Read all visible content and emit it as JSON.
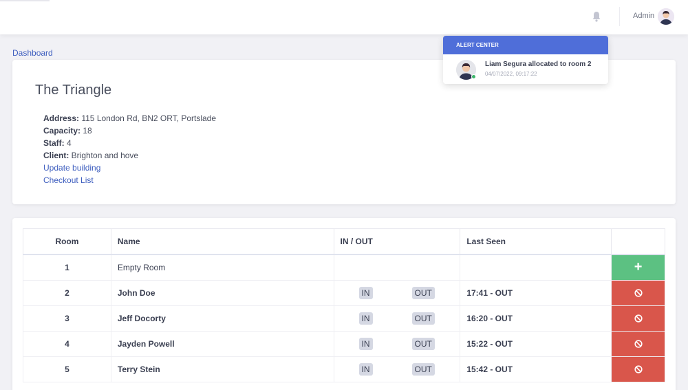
{
  "header": {
    "user_name": "Admin"
  },
  "breadcrumb": {
    "label": "Dashboard"
  },
  "building": {
    "title": "The Triangle",
    "address_label": "Address:",
    "address": " 115 London Rd, BN2 ORT, Portslade",
    "capacity_label": "Capacity:",
    "capacity": " 18",
    "staff_label": "Staff:",
    "staff": " 4",
    "client_label": "Client:",
    "client": " Brighton and hove",
    "update_link": "Update building",
    "checkout_link": "Checkout List"
  },
  "table": {
    "headers": {
      "room": "Room",
      "name": "Name",
      "io": "IN / OUT",
      "seen": "Last Seen"
    },
    "in_label": "IN",
    "out_label": "OUT",
    "add_icon": "plus-icon",
    "remove_icon": "ban-icon",
    "rows": [
      {
        "room": "1",
        "name": "Empty Room",
        "last_seen": ""
      },
      {
        "room": "2",
        "name": "John Doe",
        "last_seen": "17:41 - OUT"
      },
      {
        "room": "3",
        "name": "Jeff Docorty",
        "last_seen": "16:20 - OUT"
      },
      {
        "room": "4",
        "name": "Jayden Powell",
        "last_seen": "15:22 - OUT"
      },
      {
        "room": "5",
        "name": "Terry Stein",
        "last_seen": "15:42 - OUT"
      }
    ]
  },
  "alert_center": {
    "title": "ALERT CENTER",
    "message": "Liam Segura allocated to room 2",
    "timestamp": "04/07/2022, 09:17:22"
  },
  "colors": {
    "accent": "#4f6ed9",
    "add": "#5cc182",
    "remove": "#d9564b",
    "link": "#3f5fbf"
  }
}
